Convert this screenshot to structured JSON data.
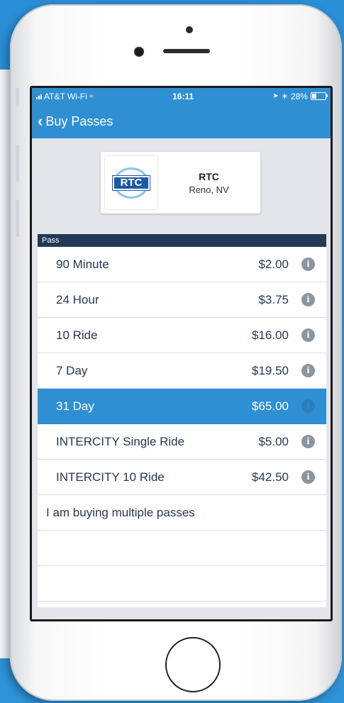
{
  "status": {
    "carrier": "AT&T Wi-Fi",
    "time": "16:11",
    "battery": "28%"
  },
  "nav": {
    "back_label": "Buy Passes"
  },
  "agency": {
    "logo_text": "RTC",
    "name": "RTC",
    "location": "Reno, NV"
  },
  "passes": {
    "header": "Pass",
    "items": [
      {
        "name": "90 Minute",
        "price": "$2.00"
      },
      {
        "name": "24 Hour",
        "price": "$3.75"
      },
      {
        "name": "10 Ride",
        "price": "$16.00"
      },
      {
        "name": "7 Day",
        "price": "$19.50"
      },
      {
        "name": "31 Day",
        "price": "$65.00",
        "selected": true
      },
      {
        "name": "INTERCITY Single Ride",
        "price": "$5.00"
      },
      {
        "name": "INTERCITY 10 Ride",
        "price": "$42.50"
      }
    ],
    "multiple_label": "I am buying multiple passes"
  },
  "colors": {
    "accent": "#2f8fd3",
    "header_bg": "#223a57"
  }
}
